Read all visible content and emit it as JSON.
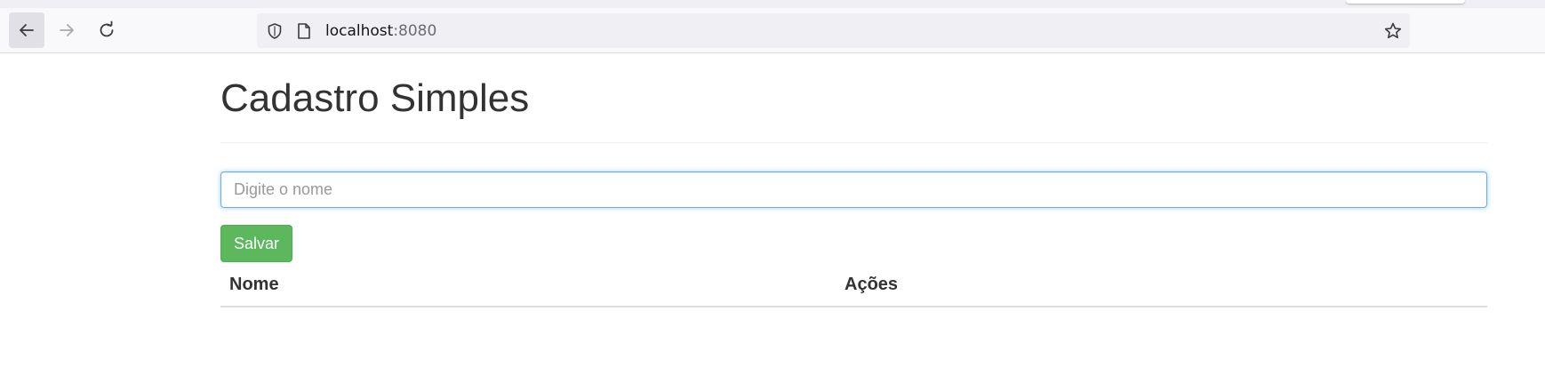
{
  "browser": {
    "url_host": "localhost",
    "url_port": ":8080",
    "icons": {
      "back": "arrow-left-icon",
      "forward": "arrow-right-icon",
      "reload": "reload-icon",
      "security": "shield-icon",
      "page": "page-icon",
      "bookmark": "star-icon"
    }
  },
  "page": {
    "title": "Cadastro Simples",
    "name_input": {
      "placeholder": "Digite o nome",
      "value": ""
    },
    "save_label": "Salvar",
    "table": {
      "headers": [
        "Nome",
        "Ações"
      ],
      "rows": []
    }
  },
  "colors": {
    "save_button": "#5cb85c",
    "input_focus_border": "#66afe9"
  }
}
